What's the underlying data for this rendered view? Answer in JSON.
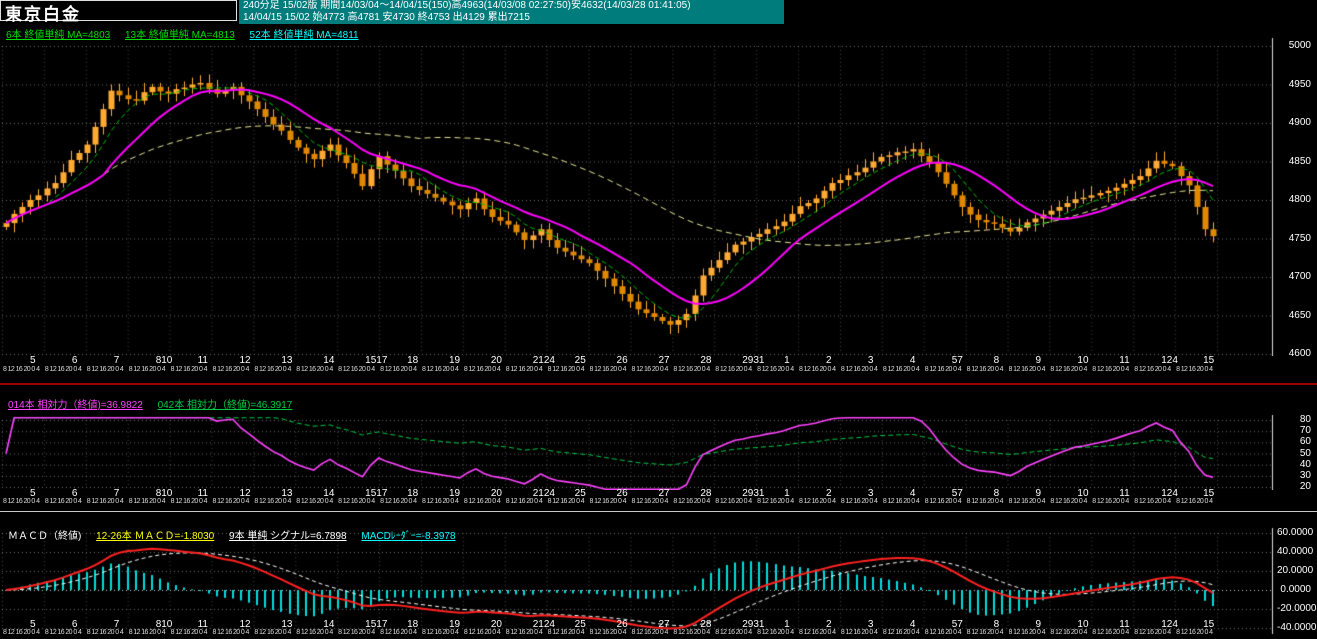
{
  "title": "東京白金",
  "header": {
    "line1": "240分足 15/02版  期間14/03/04～14/04/15(150)高4963(14/03/08 02:27:50)安4632(14/03/28 01:41:05)",
    "line2": "14/04/15 15/02 始4773 高4781 安4730 終4753 出4129 累出7215"
  },
  "ma_legend": [
    {
      "label": "6本 終値単純 MA=4803",
      "color": "#00dd00"
    },
    {
      "label": "13本 終値単純 MA=4813",
      "color": "#00dd00"
    },
    {
      "label": "52本 終値単純 MA=4811",
      "color": "#00ffff"
    }
  ],
  "rsi_legend": [
    {
      "label": "014本 相対力（終値)=36.9822",
      "color": "#ff44ff"
    },
    {
      "label": "042本 相対力（終値)=46.3917",
      "color": "#00cc44"
    }
  ],
  "macd_legend": [
    {
      "label": "ＭＡＣＤ（終値)",
      "color": "#ffffff",
      "underline": false
    },
    {
      "label": "12-26本 ＭＡＣＤ=-1.8030",
      "color": "#ffff00",
      "underline": true
    },
    {
      "label": "9本 単純 シグナル=6.7898",
      "color": "#ffffff",
      "underline": true
    },
    {
      "label": "MACDﾚｰﾀﾞｰ=-8.3978",
      "color": "#00ffff",
      "underline": true
    }
  ],
  "colors": {
    "background": "#000000",
    "teal_header": "#007c7c",
    "separator_red": "#990000",
    "separator_white": "#c8c8c8",
    "grid": "#aaaaaa"
  },
  "chart_data": [
    {
      "type": "candlestick",
      "title": "東京白金 240分足",
      "period_bars": 150,
      "ylim": [
        4600,
        5000
      ],
      "yticks": [
        "5000",
        "4950",
        "4900",
        "4850",
        "4800",
        "4750",
        "4700",
        "4650",
        "4600"
      ],
      "x_day_labels": [
        "5",
        "6",
        "7",
        "810",
        "11",
        "12",
        "13",
        "14",
        "1517",
        "18",
        "19",
        "20",
        "2124",
        "25",
        "26",
        "27",
        "28",
        "2931",
        "1",
        "2",
        "3",
        "4",
        "57",
        "8",
        "9",
        "10",
        "11",
        "124",
        "15"
      ],
      "time_label_pattern": "8 12 16 20 0 4",
      "first_open": 4765,
      "closes": [
        4770,
        4782,
        4791,
        4800,
        4806,
        4815,
        4822,
        4836,
        4852,
        4861,
        4872,
        4895,
        4918,
        4942,
        4936,
        4931,
        4929,
        4940,
        4947,
        4941,
        4938,
        4944,
        4946,
        4950,
        4952,
        4944,
        4938,
        4943,
        4947,
        4936,
        4928,
        4918,
        4908,
        4898,
        4890,
        4878,
        4868,
        4860,
        4853,
        4864,
        4872,
        4858,
        4848,
        4834,
        4818,
        4840,
        4857,
        4846,
        4838,
        4828,
        4818,
        4813,
        4808,
        4803,
        4798,
        4793,
        4788,
        4796,
        4802,
        4788,
        4778,
        4773,
        4768,
        4758,
        4748,
        4754,
        4762,
        4748,
        4738,
        4733,
        4728,
        4723,
        4718,
        4708,
        4698,
        4688,
        4678,
        4668,
        4658,
        4653,
        4648,
        4643,
        4638,
        4644,
        4652,
        4676,
        4702,
        4712,
        4722,
        4732,
        4742,
        4746,
        4752,
        4756,
        4762,
        4766,
        4772,
        4782,
        4792,
        4796,
        4802,
        4812,
        4822,
        4826,
        4832,
        4836,
        4842,
        4850,
        4856,
        4858,
        4862,
        4863,
        4866,
        4857,
        4849,
        4836,
        4821,
        4806,
        4791,
        4781,
        4774,
        4771,
        4769,
        4764,
        4759,
        4764,
        4771,
        4776,
        4781,
        4786,
        4791,
        4796,
        4801,
        4803,
        4806,
        4809,
        4812,
        4816,
        4821,
        4826,
        4831,
        4841,
        4851,
        4847,
        4844,
        4831,
        4819,
        4791,
        4762,
        4753
      ],
      "candle_up_color": "#ffaa33",
      "candle_down_color": "#e08800",
      "wick_color": "#ffaa33",
      "overlays": [
        {
          "name": "SMA6",
          "period": 6,
          "style": "dashed",
          "color": "#00bb00",
          "last_value": 4803
        },
        {
          "name": "SMA13",
          "period": 13,
          "style": "solid",
          "color": "#ff00ff",
          "last_value": 4813
        },
        {
          "name": "SMA52",
          "period": 52,
          "style": "dashed",
          "color": "#e8e89a",
          "last_value": 4811
        }
      ]
    },
    {
      "type": "line",
      "name": "相対力 RSI",
      "ylim": [
        20,
        80
      ],
      "yticks": [
        "80",
        "70",
        "60",
        "50",
        "40",
        "30",
        "20"
      ],
      "series": [
        {
          "name": "RSI14",
          "period": 14,
          "color": "#ff44ff",
          "style": "solid",
          "last_value": 36.9822
        },
        {
          "name": "RSI42",
          "period": 42,
          "color": "#00cc44",
          "style": "dashed",
          "last_value": 46.3917
        }
      ]
    },
    {
      "type": "macd",
      "name": "MACD",
      "ylim": [
        -40,
        60
      ],
      "yticks": [
        "60.0000",
        "40.0000",
        "20.0000",
        "0.0000",
        "-20.0000",
        "-40.0000"
      ],
      "fast_period": 12,
      "slow_period": 26,
      "signal_period": 9,
      "macd_color": "#ff2222",
      "signal_color": "#ffffff",
      "hist_color": "#00dddd",
      "last_macd": -1.803,
      "last_signal": 6.7898,
      "last_histogram": -8.3978
    }
  ]
}
